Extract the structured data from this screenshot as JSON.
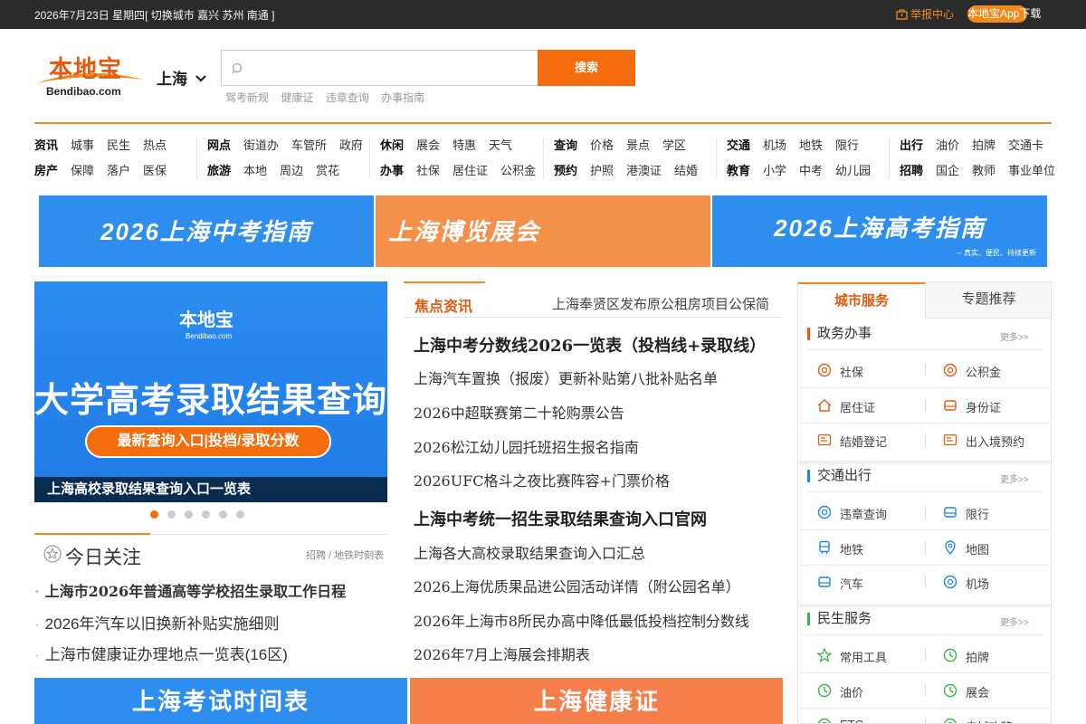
{
  "topbar": {
    "date": "2026年7月23日 星期四",
    "switch_city_label": "[ 切换城市",
    "cities": [
      "嘉兴",
      "苏州",
      "南通"
    ],
    "switch_city_end": "]",
    "report_label": "举报中心",
    "app_download_label": "本地宝App下载"
  },
  "header": {
    "logo_cn": "本地宝",
    "logo_en": "Bendibao.com",
    "city": "上海",
    "search_placeholder": "",
    "search_button": "搜索",
    "hot_words": [
      "驾考新规",
      "健康证",
      "违章查询",
      "办事指南"
    ]
  },
  "nav": {
    "groups": [
      {
        "rows": [
          [
            "资讯",
            "城事",
            "民生",
            "热点"
          ],
          [
            "房产",
            "保障",
            "落户",
            "医保"
          ]
        ]
      },
      {
        "rows": [
          [
            "网点",
            "街道办",
            "车管所",
            "政府"
          ],
          [
            "旅游",
            "本地",
            "周边",
            "赏花"
          ]
        ]
      },
      {
        "rows": [
          [
            "休闲",
            "展会",
            "特惠",
            "天气"
          ],
          [
            "办事",
            "社保",
            "居住证",
            "公积金"
          ]
        ]
      },
      {
        "rows": [
          [
            "查询",
            "价格",
            "景点",
            "学区"
          ],
          [
            "预约",
            "护照",
            "港澳证",
            "结婚"
          ]
        ]
      },
      {
        "rows": [
          [
            "交通",
            "机场",
            "地铁",
            "限行"
          ],
          [
            "教育",
            "小学",
            "中考",
            "幼儿园"
          ]
        ]
      },
      {
        "rows": [
          [
            "出行",
            "油价",
            "拍牌",
            "交通卡"
          ],
          [
            "招聘",
            "国企",
            "教师",
            "事业单位"
          ]
        ]
      }
    ]
  },
  "banners": [
    {
      "text": "2026上海中考指南",
      "color": "#2d8ef0"
    },
    {
      "text": "上海博览展会",
      "color": "#f5904a"
    },
    {
      "text": "2026上海高考指南",
      "subtext": "-- 真实、便民、持续更新",
      "color": "#2d8ef0"
    }
  ],
  "carousel": {
    "logo_cn": "本地宝",
    "logo_en": "Bendibao.com",
    "headline": "大学高考录取结果查询",
    "pill": "最新查询入口|投档/录取分数",
    "caption": "上海高校录取结果查询入口一览表",
    "dot_count": 6,
    "active_dot": 0
  },
  "today": {
    "title": "今日关注",
    "more": "招聘 / 地铁时刻表",
    "items": [
      {
        "text": "上海市2026年普通高等学校招生录取工作日程",
        "bold": true
      },
      {
        "text": "2026年汽车以旧换新补贴实施细则",
        "bold": false
      },
      {
        "text": "上海市健康证办理地点一览表(16区)",
        "bold": false
      }
    ]
  },
  "focus": {
    "tab": "焦点资讯",
    "marquee": "上海奉贤区发布原公租房项目公保简",
    "news": [
      {
        "text": "上海中考分数线2026一览表（投档线+录取线）",
        "headline": true
      },
      {
        "text": "上海汽车置换（报废）更新补贴第八批补贴名单",
        "headline": false
      },
      {
        "text": "2026中超联赛第二十轮购票公告",
        "headline": false
      },
      {
        "text": "2026松江幼儿园托班招生报名指南",
        "headline": false
      },
      {
        "text": "2026UFC格斗之夜比赛阵容+门票价格",
        "headline": false
      },
      {
        "text": "上海中考统一招生录取结果查询入口官网",
        "headline": true
      },
      {
        "text": "上海各大高校录取结果查询入口汇总",
        "headline": false
      },
      {
        "text": "2026上海优质果品进公园活动详情（附公园名单）",
        "headline": false
      },
      {
        "text": "2026年上海市8所民办高中降低最低投档控制分数线",
        "headline": false
      },
      {
        "text": "2026年7月上海展会排期表",
        "headline": false
      }
    ]
  },
  "sidebar": {
    "tabs": [
      "城市服务",
      "专题推荐"
    ],
    "more_label": "更多>>",
    "sections": [
      {
        "title": "政务办事",
        "items": [
          [
            "社保",
            "shebao-icon"
          ],
          [
            "公积金",
            "gongjijin-icon"
          ],
          [
            "居住证",
            "home-icon"
          ],
          [
            "身份证",
            "id-card-icon"
          ],
          [
            "结婚登记",
            "marriage-icon"
          ],
          [
            "出入境预约",
            "passport-icon"
          ]
        ]
      },
      {
        "title": "交通出行",
        "items": [
          [
            "违章查询",
            "violation-icon"
          ],
          [
            "限行",
            "car-limit-icon"
          ],
          [
            "地铁",
            "subway-icon"
          ],
          [
            "地图",
            "map-pin-icon"
          ],
          [
            "汽车",
            "car-icon"
          ],
          [
            "机场",
            "airport-icon"
          ]
        ]
      },
      {
        "title": "民生服务",
        "items": [
          [
            "常用工具",
            "star-icon"
          ],
          [
            "拍牌",
            "clock-icon"
          ],
          [
            "油价",
            "oil-icon"
          ],
          [
            "展会",
            "expo-icon"
          ],
          [
            "ETC",
            "etc-icon"
          ],
          [
            "电城攻略",
            "guide-icon"
          ]
        ]
      }
    ]
  },
  "bottom_banners": [
    {
      "text": "上海考试时间表",
      "color": "#2d8ef0"
    },
    {
      "text": "上海健康证",
      "color": "#f57e4a"
    }
  ],
  "colors": {
    "accent": "#f08a1d",
    "search_button": "#f56c0c",
    "topbar_bg": "#2b2b2b",
    "banner_blue": "#2d8ef0",
    "banner_orange": "#f5904a"
  }
}
